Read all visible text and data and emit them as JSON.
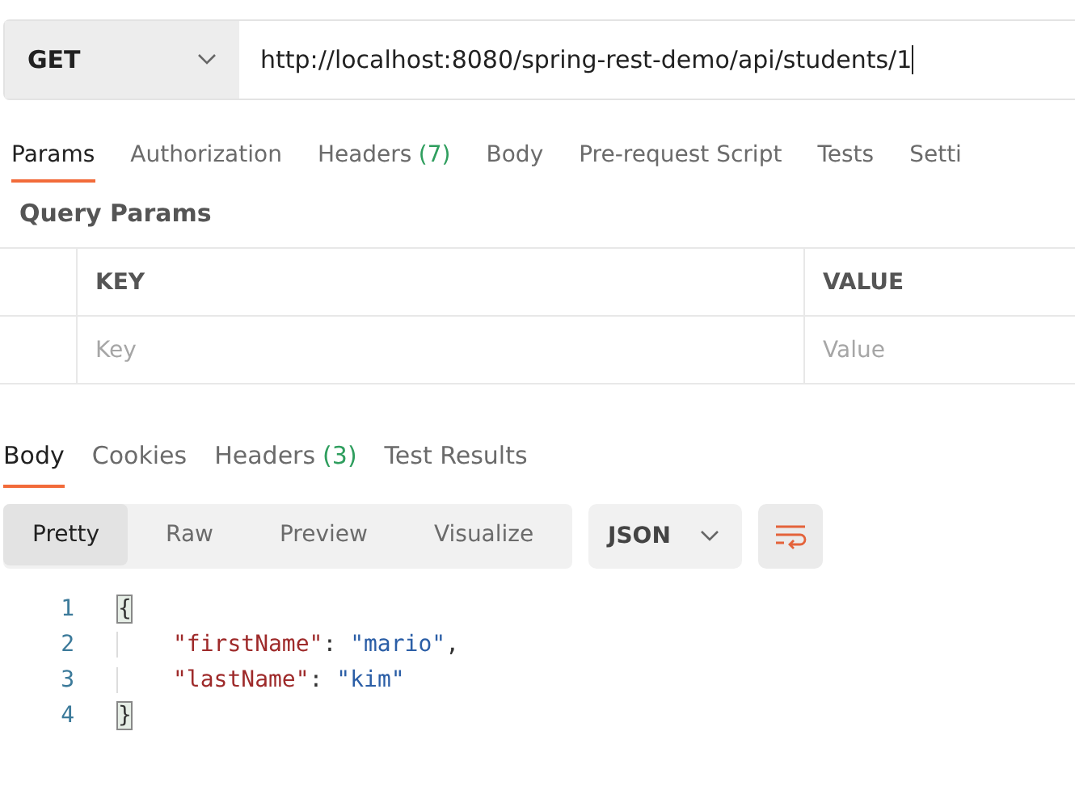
{
  "request": {
    "method": "GET",
    "url": "http://localhost:8080/spring-rest-demo/api/students/1"
  },
  "request_tabs": [
    {
      "label": "Params",
      "selected": true
    },
    {
      "label": "Authorization",
      "selected": false
    },
    {
      "label": "Headers",
      "count": "(7)",
      "selected": false
    },
    {
      "label": "Body",
      "selected": false
    },
    {
      "label": "Pre-request Script",
      "selected": false
    },
    {
      "label": "Tests",
      "selected": false
    },
    {
      "label": "Setti",
      "selected": false
    }
  ],
  "query_params": {
    "title": "Query Params",
    "columns": [
      "KEY",
      "VALUE"
    ],
    "placeholders": [
      "Key",
      "Value"
    ]
  },
  "response_tabs": [
    {
      "label": "Body",
      "selected": true
    },
    {
      "label": "Cookies",
      "selected": false
    },
    {
      "label": "Headers",
      "count": "(3)",
      "selected": false
    },
    {
      "label": "Test Results",
      "selected": false
    }
  ],
  "view_modes": [
    {
      "label": "Pretty",
      "selected": true
    },
    {
      "label": "Raw",
      "selected": false
    },
    {
      "label": "Preview",
      "selected": false
    },
    {
      "label": "Visualize",
      "selected": false
    }
  ],
  "format": "JSON",
  "code_lines": [
    {
      "number": "1",
      "indented": false,
      "tokens": [
        {
          "kind": "brace",
          "text": "{"
        }
      ]
    },
    {
      "number": "2",
      "indented": true,
      "tokens": [
        {
          "kind": "key",
          "text": "\"firstName\""
        },
        {
          "kind": "punct",
          "text": ": "
        },
        {
          "kind": "string",
          "text": "\"mario\""
        },
        {
          "kind": "punct",
          "text": ","
        }
      ]
    },
    {
      "number": "3",
      "indented": true,
      "tokens": [
        {
          "kind": "key",
          "text": "\"lastName\""
        },
        {
          "kind": "punct",
          "text": ": "
        },
        {
          "kind": "string",
          "text": "\"kim\""
        }
      ]
    },
    {
      "number": "4",
      "indented": false,
      "tokens": [
        {
          "kind": "brace",
          "text": "}"
        }
      ]
    }
  ]
}
